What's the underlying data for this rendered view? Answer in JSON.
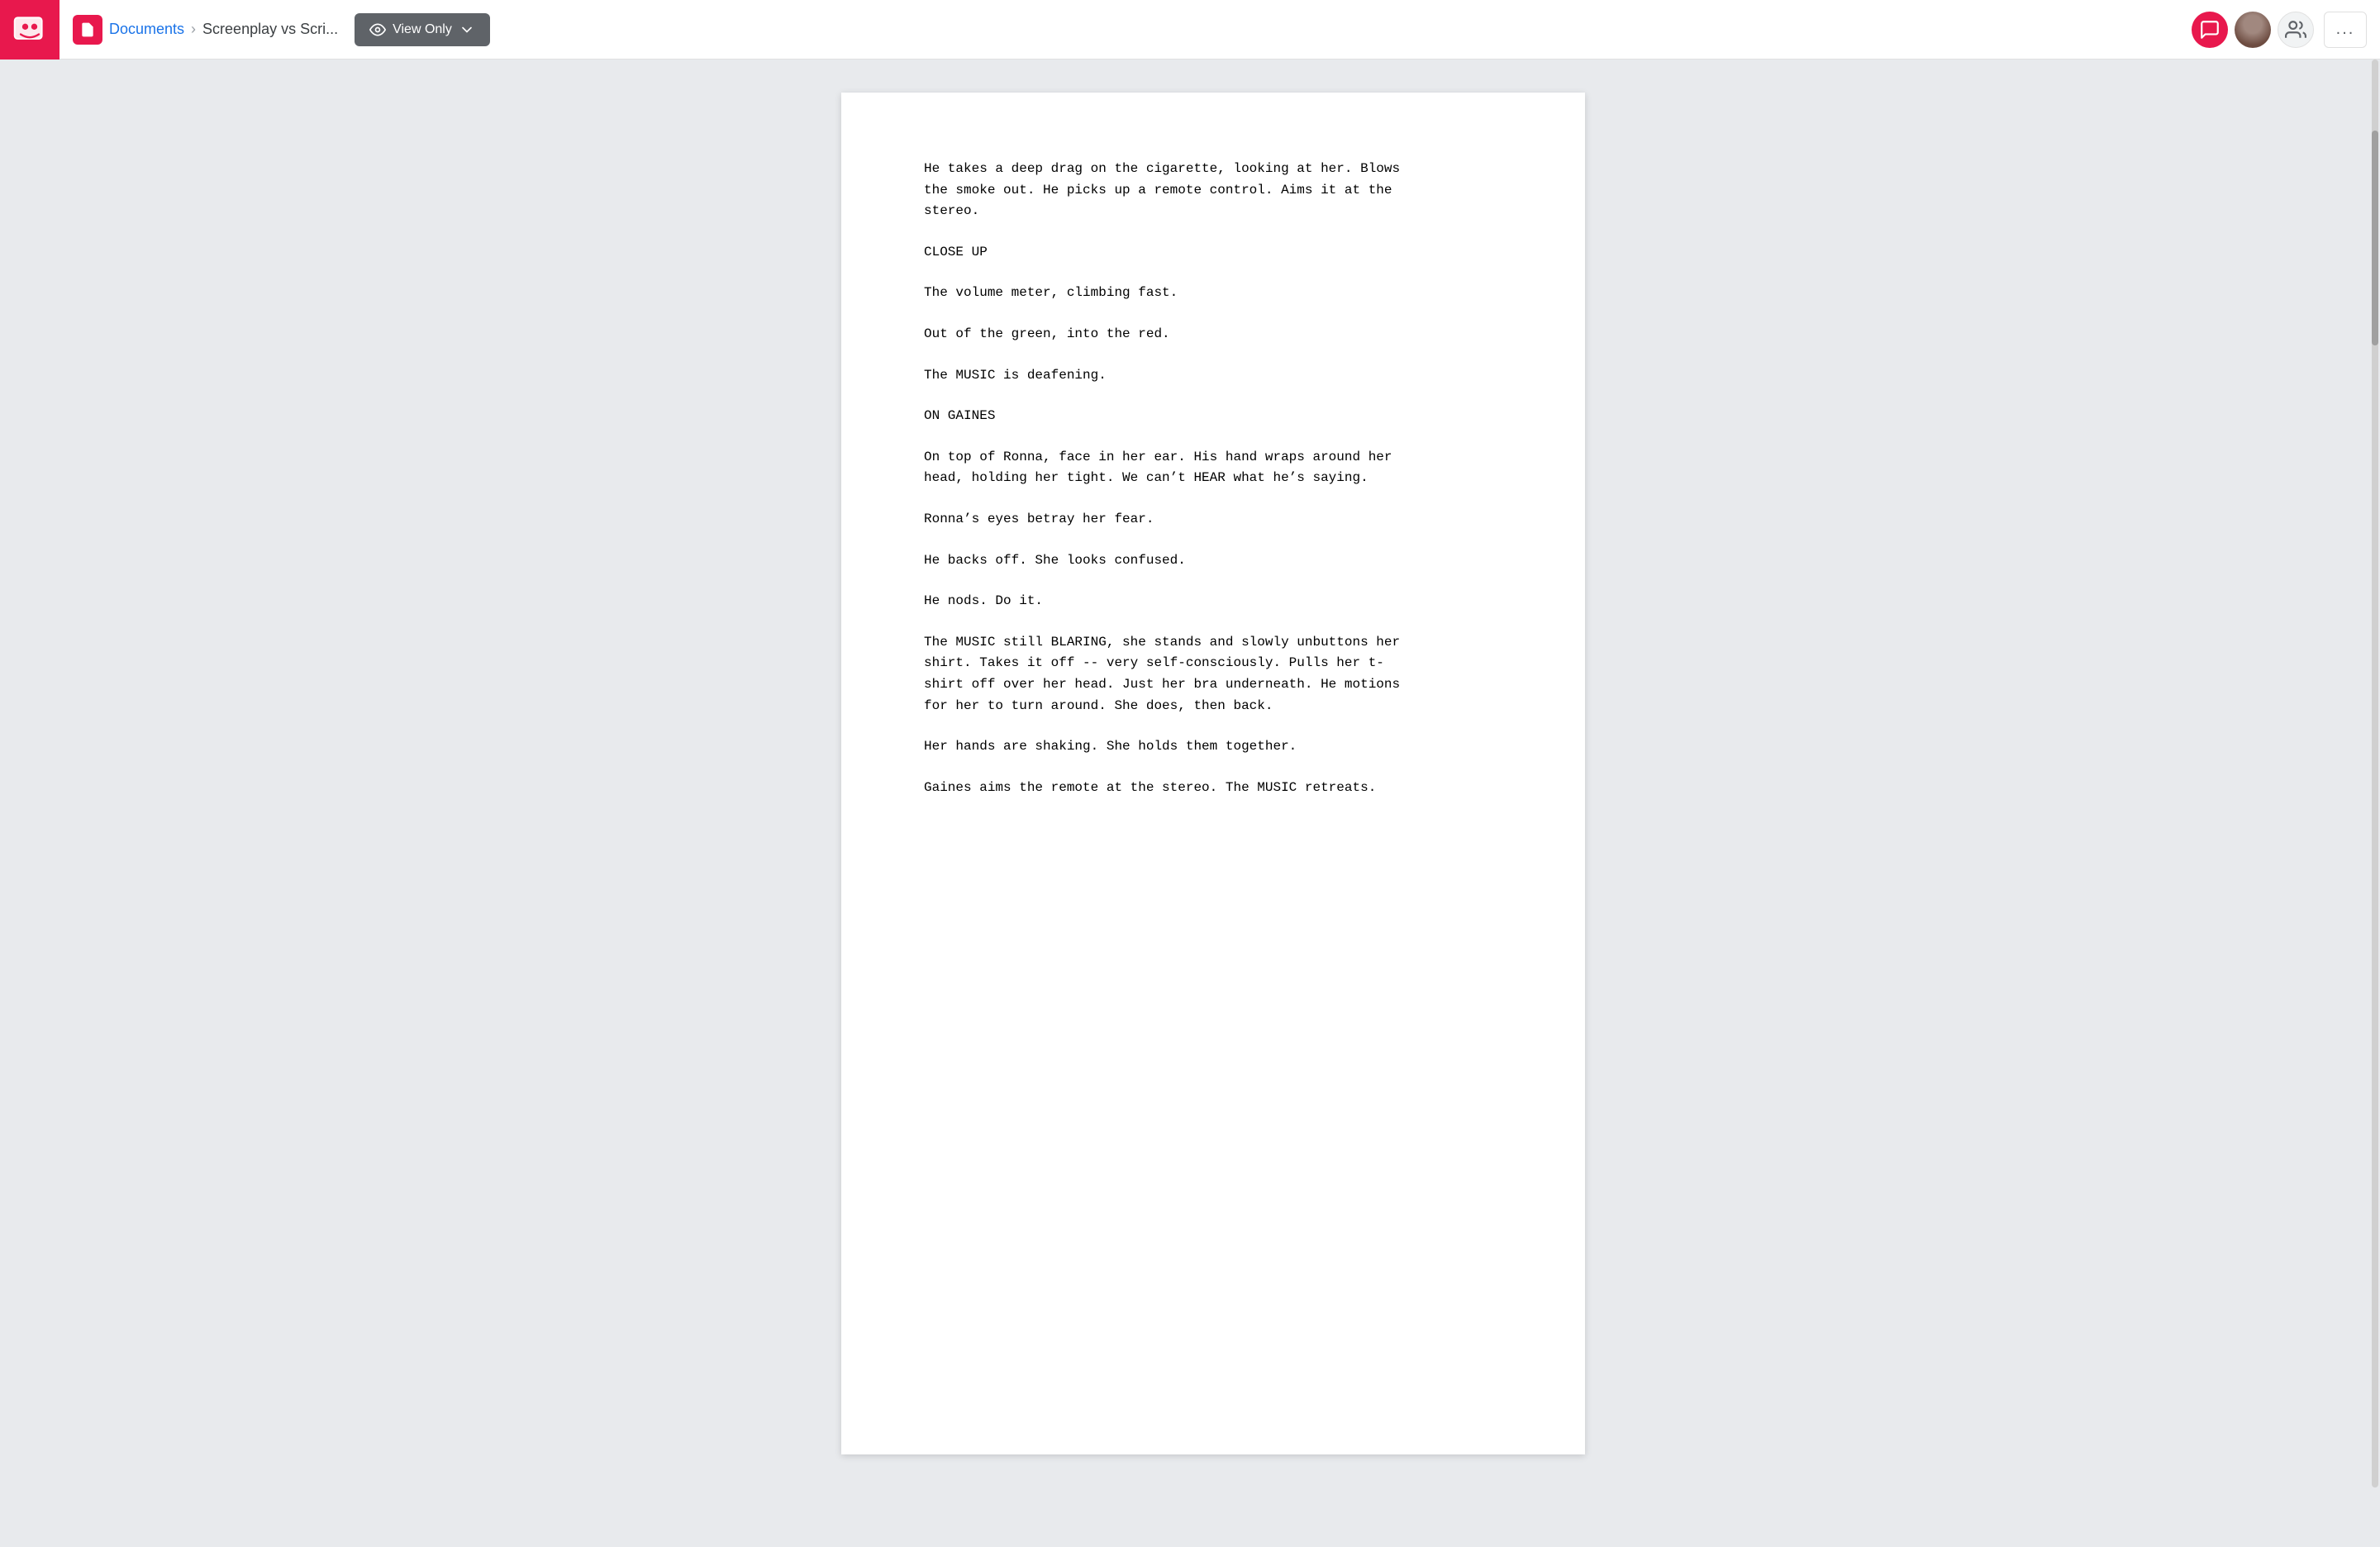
{
  "navbar": {
    "logo_alt": "App Logo",
    "breadcrumb": {
      "home_label": "Documents",
      "separator": "›",
      "current_label": "Screenplay vs Scri..."
    },
    "view_only_label": "View Only",
    "more_label": "..."
  },
  "document": {
    "blocks": [
      {
        "text": "He takes a deep drag on the cigarette, looking at her. Blows\nthe smoke out. He picks up a remote control. Aims it at the\nstereo."
      },
      {
        "text": "CLOSE UP"
      },
      {
        "text": "The volume meter, climbing fast."
      },
      {
        "text": "Out of the green, into the red."
      },
      {
        "text": "The MUSIC is deafening."
      },
      {
        "text": "ON GAINES"
      },
      {
        "text": "On top of Ronna, face in her ear. His hand wraps around her\nhead, holding her tight. We can’t HEAR what he’s saying."
      },
      {
        "text": "Ronna’s eyes betray her fear."
      },
      {
        "text": "He backs off. She looks confused."
      },
      {
        "text": "He nods. Do it."
      },
      {
        "text": "The MUSIC still BLARING, she stands and slowly unbuttons her\nshirt. Takes it off -- very self-consciously. Pulls her t-\nshirt off over her head. Just her bra underneath. He motions\nfor her to turn around. She does, then back."
      },
      {
        "text": "Her hands are shaking. She holds them together."
      },
      {
        "text": "Gaines aims the remote at the stereo. The MUSIC retreats."
      }
    ]
  }
}
